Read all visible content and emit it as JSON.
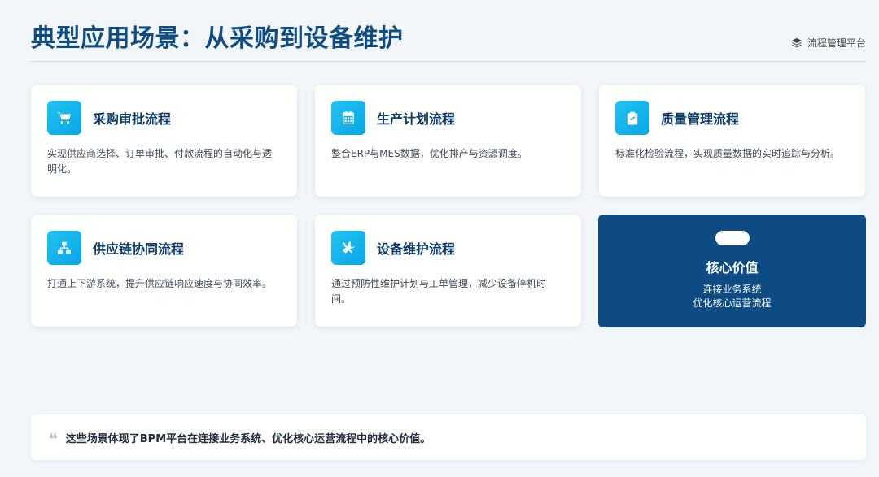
{
  "header": {
    "title": "典型应用场景：从采购到设备维护",
    "platform_icon": "layers-icon",
    "platform_label": "流程管理平台"
  },
  "cards": [
    {
      "icon": "cart-icon",
      "title": "采购审批流程",
      "desc": "实现供应商选择、订单审批、付款流程的自动化与透明化。"
    },
    {
      "icon": "calendar-icon",
      "title": "生产计划流程",
      "desc": "整合ERP与MES数据，优化排产与资源调度。"
    },
    {
      "icon": "clipboard-check-icon",
      "title": "质量管理流程",
      "desc": "标准化检验流程，实现质量数据的实时追踪与分析。"
    },
    {
      "icon": "network-icon",
      "title": "供应链协同流程",
      "desc": "打通上下游系统，提升供应链响应速度与协同效率。"
    },
    {
      "icon": "tools-icon",
      "title": "设备维护流程",
      "desc": "通过预防性维护计划与工单管理，减少设备停机时间。"
    }
  ],
  "value_card": {
    "title": "核心价值",
    "line1": "连接业务系统",
    "line2": "优化核心运营流程"
  },
  "quote": {
    "mark": "❝",
    "text": "这些场景体现了BPM平台在连接业务系统、优化核心运营流程中的核心价值。"
  },
  "colors": {
    "title": "#0f4c81",
    "accent": "#0aa5e6",
    "value_bg": "#0d4b82"
  }
}
